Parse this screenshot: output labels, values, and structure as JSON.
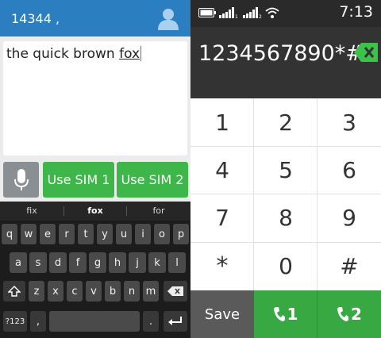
{
  "compose": {
    "recipient": "14344 ,",
    "message_text": "the quick brown ",
    "message_last_word": "fox",
    "sim1_label": "Use SIM 1",
    "sim2_label": "Use SIM 2"
  },
  "keyboard": {
    "suggestions": [
      "fix",
      "fox",
      "for"
    ],
    "row1": [
      "q",
      "w",
      "e",
      "r",
      "t",
      "y",
      "u",
      "i",
      "o",
      "p"
    ],
    "row2": [
      "a",
      "s",
      "d",
      "f",
      "g",
      "h",
      "j",
      "k",
      "l"
    ],
    "row3": [
      "z",
      "x",
      "c",
      "v",
      "b",
      "n",
      "m"
    ],
    "symbols_label": "?123",
    "comma_label": ",",
    "period_label": "."
  },
  "dialer": {
    "time": "7:13",
    "number": "1234567890*#",
    "keys": [
      "1",
      "2",
      "3",
      "4",
      "5",
      "6",
      "7",
      "8",
      "9",
      "*",
      "0",
      "#"
    ],
    "save_label": "Save",
    "call1_label": "1",
    "call2_label": "2"
  },
  "colors": {
    "accent_blue": "#2b7fc1",
    "sim_green": "#3fb64a",
    "call_green": "#38a843",
    "delete_green": "#3cc14a",
    "status_bar": "#2a2a2a",
    "dialer_header": "#333333"
  }
}
